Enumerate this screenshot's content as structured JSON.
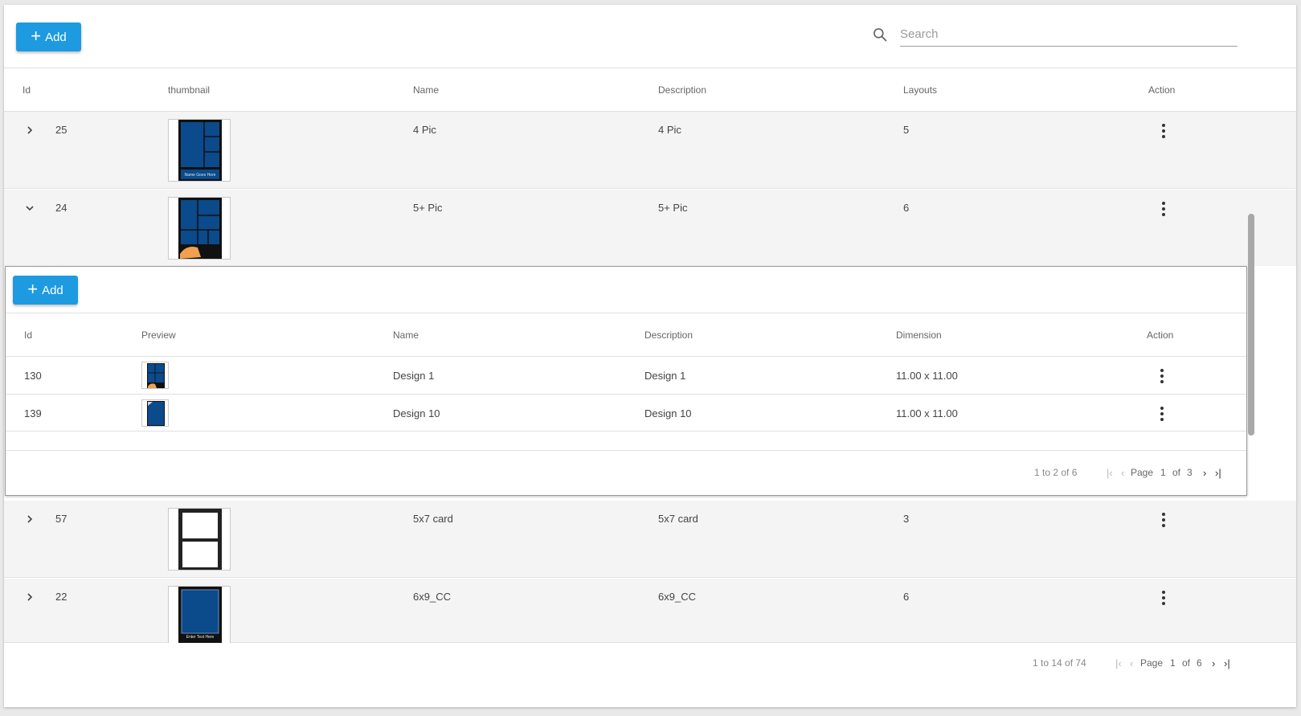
{
  "toolbar": {
    "add_label": "Add",
    "search_placeholder": "Search"
  },
  "table": {
    "headers": {
      "id": "Id",
      "thumbnail": "thumbnail",
      "name": "Name",
      "description": "Description",
      "layouts": "Layouts",
      "action": "Action"
    },
    "rows": [
      {
        "id": "25",
        "name": "4 Pic",
        "description": "4 Pic",
        "layouts": "5",
        "expanded": false
      },
      {
        "id": "24",
        "name": "5+ Pic",
        "description": "5+ Pic",
        "layouts": "6",
        "expanded": true
      },
      {
        "id": "57",
        "name": "5x7 card",
        "description": "5x7 card",
        "layouts": "3",
        "expanded": false
      },
      {
        "id": "22",
        "name": "6x9_CC",
        "description": "6x9_CC",
        "layouts": "6",
        "expanded": false
      }
    ],
    "pager": {
      "range": "1 to 14 of 74",
      "page_label": "Page",
      "page": "1",
      "of_label": "of",
      "total_pages": "6"
    }
  },
  "detail": {
    "add_label": "Add",
    "headers": {
      "id": "Id",
      "preview": "Preview",
      "name": "Name",
      "description": "Description",
      "dimension": "Dimension",
      "action": "Action"
    },
    "rows": [
      {
        "id": "130",
        "name": "Design 1",
        "description": "Design 1",
        "dimension": "11.00 x 11.00"
      },
      {
        "id": "139",
        "name": "Design 10",
        "description": "Design 10",
        "dimension": "11.00 x 11.00"
      }
    ],
    "pager": {
      "range": "1 to 2 of 6",
      "page_label": "Page",
      "page": "1",
      "of_label": "of",
      "total_pages": "3"
    }
  },
  "thumbnail_texts": {
    "row25": "Name Goes Here",
    "row22": "Enter Text Here"
  },
  "colors": {
    "accent": "#1e9ae0",
    "thumb_blue": "#0b4a8b"
  },
  "icons": {
    "search": "search-icon",
    "expand": "chevron-right-icon",
    "collapse": "chevron-down-icon",
    "more": "more-vert-icon"
  }
}
